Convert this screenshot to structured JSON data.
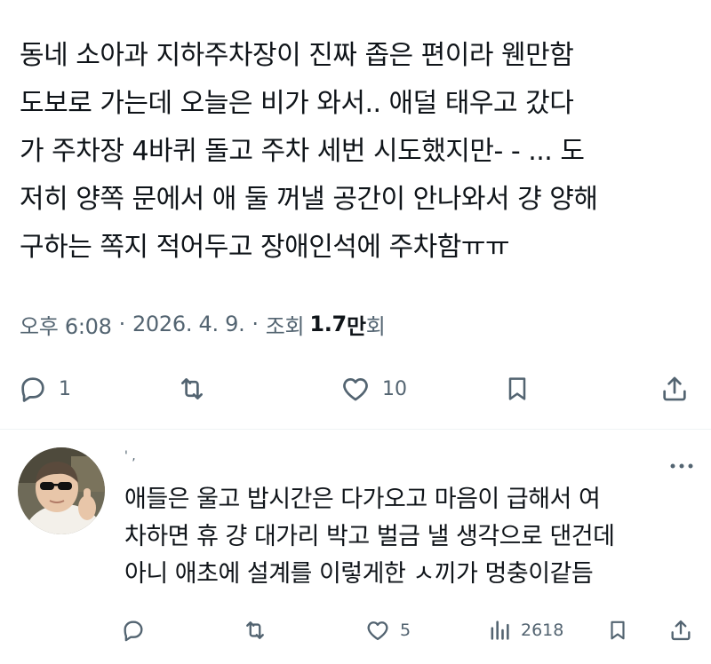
{
  "tweet": {
    "text": "동네 소아과 지하주차장이 진짜 좁은 편이라 웬만함\n도보로 가는데 오늘은 비가 와서.. 애덜 태우고 갔다\n가 주차장 4바퀴 돌고 주차 세번 시도했지만- - ... 도\n저히 양쪽 문에서 애 둘 꺼낼 공간이 안나와서 걍 양해\n구하는 쪽지 적어두고 장애인석에 주차함ㅠㅠ",
    "time": "오후 6:08",
    "sep1": "·",
    "date": "2026. 4. 9.",
    "sep2": "·",
    "views_label": "조회",
    "views_number": "1.7",
    "views_unit": "만",
    "views_suffix": "회",
    "actions": {
      "reply_icon": "reply-icon",
      "reply_count": "1",
      "retweet_icon": "retweet-icon",
      "like_icon": "heart-icon",
      "like_count": "10",
      "bookmark_icon": "bookmark-icon",
      "share_icon": "share-icon"
    }
  },
  "reply": {
    "avatar": "child-with-sunglasses-avatar",
    "meta_marks": "' ,",
    "text": "애들은 울고 밥시간은 다가오고 마음이 급해서 여\n차하면 휴 걍 대가리 박고 벌금 낼 생각으로 댄건데\n아니 애초에 설계를 이렇게한 ㅅ끼가 멍충이같듬",
    "actions": {
      "like_count": "5",
      "views_count": "2618"
    }
  },
  "colors": {
    "text": "#0f1419",
    "secondary": "#536471",
    "divider": "#eff3f4"
  }
}
